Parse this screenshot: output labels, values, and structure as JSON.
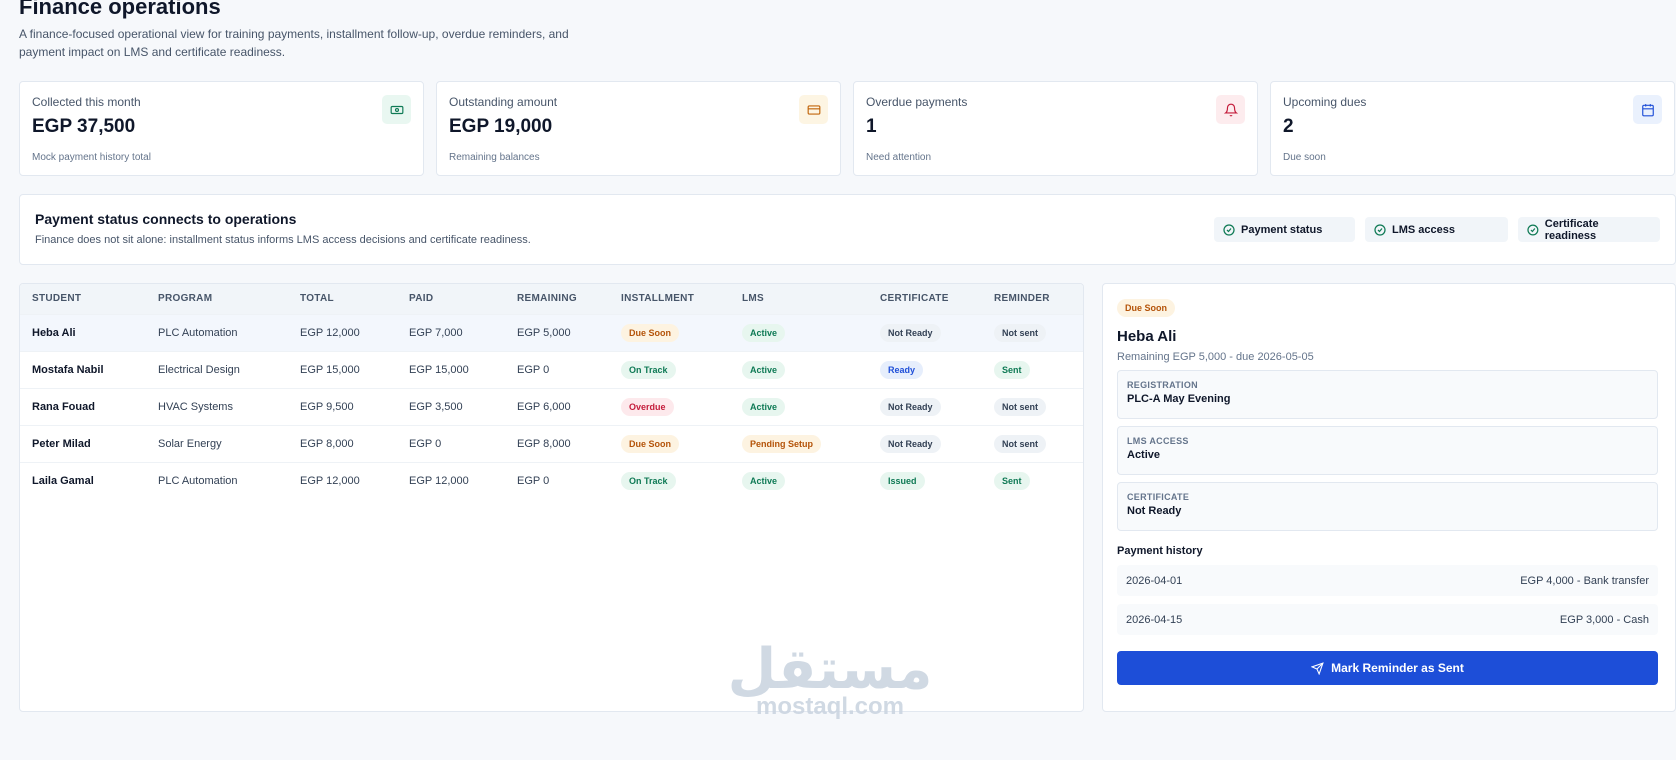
{
  "header": {
    "title": "Finance operations",
    "subtitle": "A finance-focused operational view for training payments, installment follow-up, overdue reminders, and payment impact on LMS and certificate readiness."
  },
  "kpis": [
    {
      "label": "Collected this month",
      "value": "EGP 37,500",
      "note": "Mock payment history total",
      "icon": "cash-icon",
      "color": "#0f7a55"
    },
    {
      "label": "Outstanding amount",
      "value": "EGP 19,000",
      "note": "Remaining balances",
      "icon": "card-icon",
      "color": "#c2660c"
    },
    {
      "label": "Overdue payments",
      "value": "1",
      "note": "Need attention",
      "icon": "bell-icon",
      "color": "#c41c3b"
    },
    {
      "label": "Upcoming dues",
      "value": "2",
      "note": "Due soon",
      "icon": "calendar-icon",
      "color": "#1f4fd8"
    }
  ],
  "banner": {
    "title": "Payment status connects to operations",
    "text": "Finance does not sit alone: installment status informs LMS access decisions and certificate readiness.",
    "chips": [
      "Payment status",
      "LMS access",
      "Certificate readiness"
    ]
  },
  "table": {
    "columns": [
      "STUDENT",
      "PROGRAM",
      "TOTAL",
      "PAID",
      "REMAINING",
      "INSTALLMENT",
      "LMS",
      "CERTIFICATE",
      "REMINDER"
    ],
    "rows": [
      {
        "student": "Heba Ali",
        "program": "PLC Automation",
        "total": "EGP 12,000",
        "paid": "EGP 7,000",
        "remaining": "EGP 5,000",
        "installment": "Due Soon",
        "lms": "Active",
        "certificate": "Not Ready",
        "reminder": "Not sent"
      },
      {
        "student": "Mostafa Nabil",
        "program": "Electrical Design",
        "total": "EGP 15,000",
        "paid": "EGP 15,000",
        "remaining": "EGP 0",
        "installment": "On Track",
        "lms": "Active",
        "certificate": "Ready",
        "reminder": "Sent"
      },
      {
        "student": "Rana Fouad",
        "program": "HVAC Systems",
        "total": "EGP 9,500",
        "paid": "EGP 3,500",
        "remaining": "EGP 6,000",
        "installment": "Overdue",
        "lms": "Active",
        "certificate": "Not Ready",
        "reminder": "Not sent"
      },
      {
        "student": "Peter Milad",
        "program": "Solar Energy",
        "total": "EGP 8,000",
        "paid": "EGP 0",
        "remaining": "EGP 8,000",
        "installment": "Due Soon",
        "lms": "Pending Setup",
        "certificate": "Not Ready",
        "reminder": "Not sent"
      },
      {
        "student": "Laila Gamal",
        "program": "PLC Automation",
        "total": "EGP 12,000",
        "paid": "EGP 12,000",
        "remaining": "EGP 0",
        "installment": "On Track",
        "lms": "Active",
        "certificate": "Issued",
        "reminder": "Sent"
      }
    ]
  },
  "detail": {
    "badge": "Due Soon",
    "name": "Heba Ali",
    "remaining": "Remaining EGP 5,000 - due 2026-05-05",
    "fields": [
      {
        "label": "REGISTRATION",
        "value": "PLC-A May Evening"
      },
      {
        "label": "LMS ACCESS",
        "value": "Active"
      },
      {
        "label": "CERTIFICATE",
        "value": "Not Ready"
      }
    ],
    "history_title": "Payment history",
    "history": [
      {
        "date": "2026-04-01",
        "amount": "EGP 4,000 - Bank transfer"
      },
      {
        "date": "2026-04-15",
        "amount": "EGP 3,000 - Cash"
      }
    ],
    "cta": "Mark Reminder as Sent"
  },
  "watermark": {
    "arabic": "مستقل",
    "latin": "mostaql.com"
  }
}
